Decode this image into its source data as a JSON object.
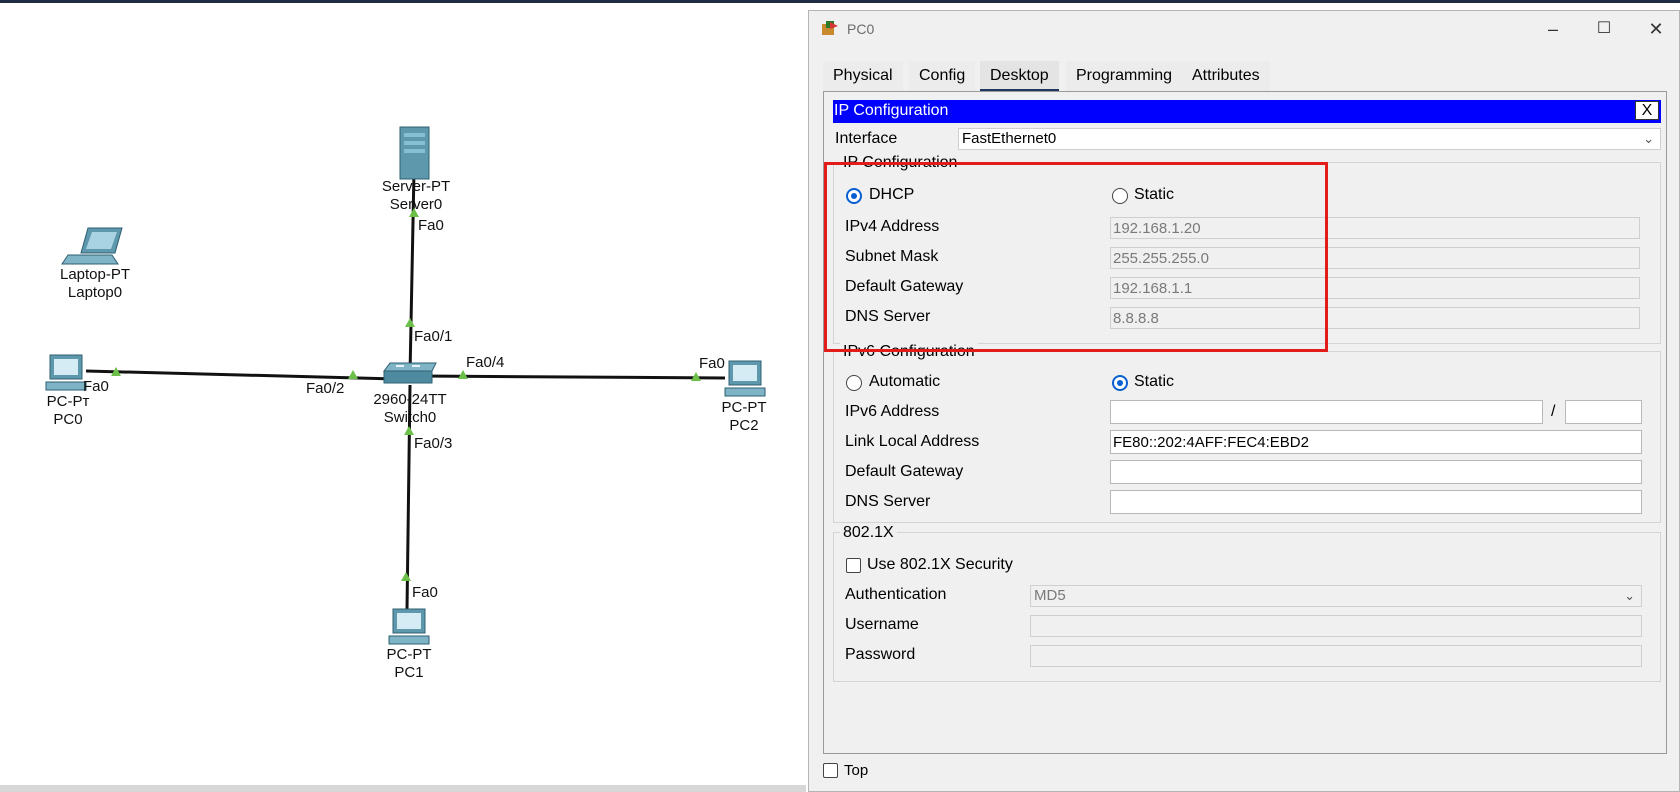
{
  "topology": {
    "devices": [
      {
        "name": "server0",
        "type": "Server-PT",
        "label": "Server0",
        "ports": [
          "Fa0"
        ]
      },
      {
        "name": "laptop0",
        "type": "Laptop-PT",
        "label": "Laptop0",
        "ports": []
      },
      {
        "name": "pc0",
        "type": "PC-PT",
        "label": "PC0",
        "ports": [
          "Fa0"
        ]
      },
      {
        "name": "switch0",
        "type": "2960-24TT",
        "label": "Switch0",
        "ports": [
          "Fa0/1",
          "Fa0/2",
          "Fa0/3",
          "Fa0/4"
        ]
      },
      {
        "name": "pc2",
        "type": "PC-PT",
        "label": "PC2",
        "ports": [
          "Fa0"
        ]
      },
      {
        "name": "pc1",
        "type": "PC-PT",
        "label": "PC1",
        "ports": [
          "Fa0"
        ]
      }
    ],
    "pc0_type_visible": "PC-Pт"
  },
  "window": {
    "title": "PC0",
    "min_glyph": "–",
    "max_glyph": "☐",
    "close_glyph": "✕"
  },
  "tabs": [
    "Physical",
    "Config",
    "Desktop",
    "Programming",
    "Attributes"
  ],
  "active_tab": "Desktop",
  "ip_config": {
    "header": "IP Configuration",
    "close_label": "X",
    "interface_label": "Interface",
    "interface_value": "FastEthernet0",
    "ipv4": {
      "title": "IP Configuration",
      "dhcp_label": "DHCP",
      "static_label": "Static",
      "mode": "DHCP",
      "ipv4_address_label": "IPv4 Address",
      "ipv4_address": "192.168.1.20",
      "subnet_mask_label": "Subnet Mask",
      "subnet_mask": "255.255.255.0",
      "default_gateway_label": "Default Gateway",
      "default_gateway": "192.168.1.1",
      "dns_server_label": "DNS Server",
      "dns_server": "8.8.8.8"
    },
    "ipv6": {
      "title": "IPv6 Configuration",
      "automatic_label": "Automatic",
      "static_label": "Static",
      "mode": "Static",
      "ipv6_address_label": "IPv6 Address",
      "ipv6_address": "",
      "prefix_separator": "/",
      "prefix_length": "",
      "link_local_label": "Link Local Address",
      "link_local": "FE80::202:4AFF:FEC4:EBD2",
      "default_gateway_label": "Default Gateway",
      "default_gateway": "",
      "dns_server_label": "DNS Server",
      "dns_server": ""
    },
    "dot1x": {
      "title": "802.1X",
      "use_label": "Use 802.1X Security",
      "use_checked": false,
      "authentication_label": "Authentication",
      "authentication_value": "MD5",
      "username_label": "Username",
      "username": "",
      "password_label": "Password",
      "password": ""
    }
  },
  "footer": {
    "top_label": "Top",
    "top_checked": false
  },
  "colors": {
    "highlight": "#e21b1b",
    "ip_header": "#0000ff",
    "radio_checked": "#0a5fd0",
    "link_marker": "#6cc04a"
  }
}
